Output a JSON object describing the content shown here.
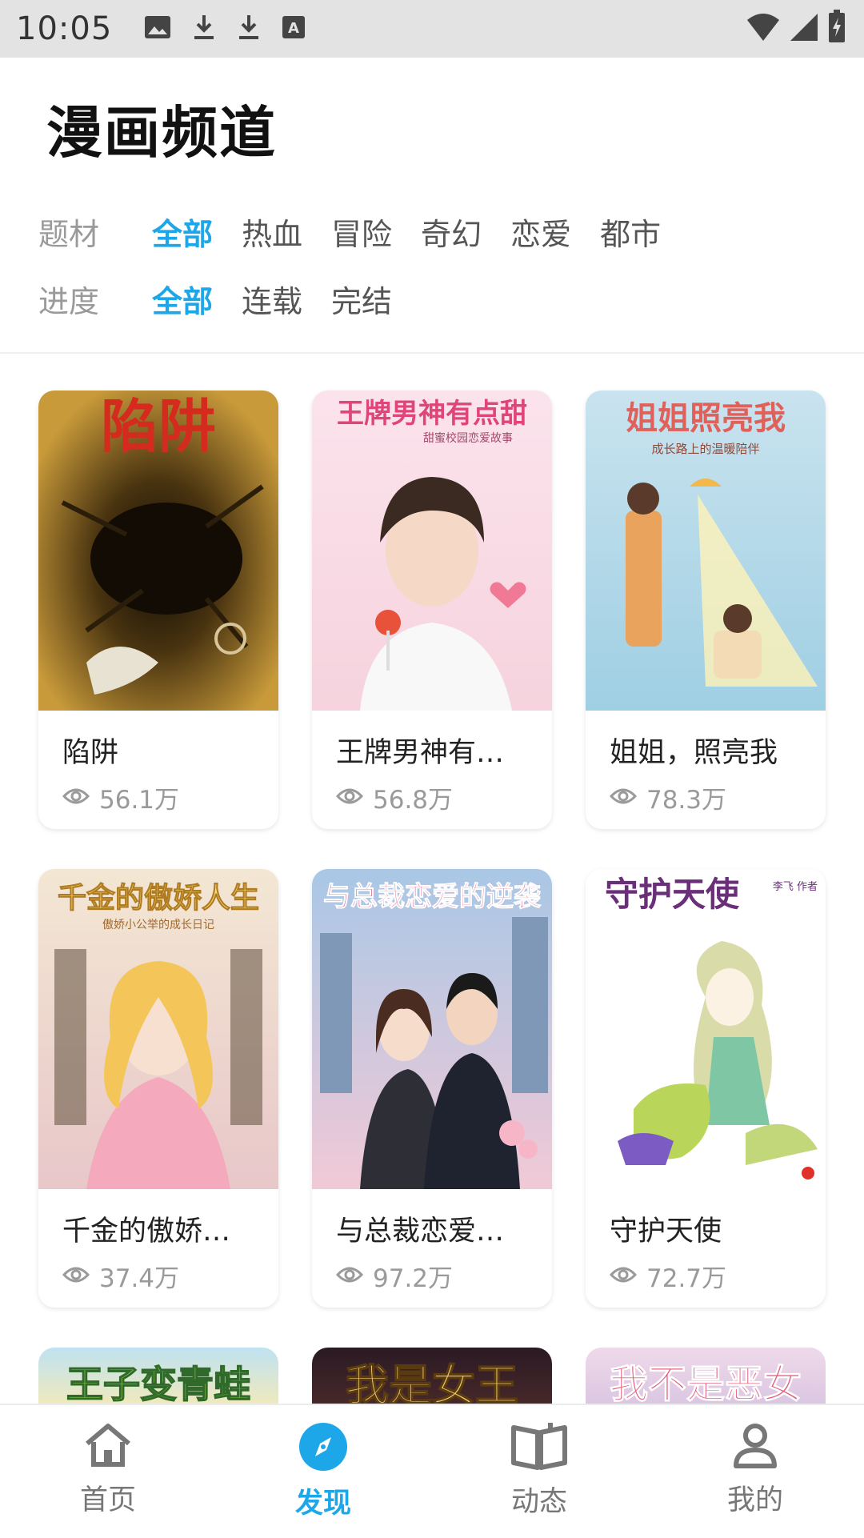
{
  "status_bar": {
    "time": "10:05",
    "icons": [
      "image-icon",
      "download-icon",
      "download-icon",
      "font-icon",
      "wifi-icon",
      "signal-icon",
      "battery-icon"
    ]
  },
  "page": {
    "title": "漫画频道"
  },
  "filters": {
    "genre": {
      "label": "题材",
      "options": [
        "全部",
        "热血",
        "冒险",
        "奇幻",
        "恋爱",
        "都市"
      ],
      "selected": "全部"
    },
    "progress": {
      "label": "进度",
      "options": [
        "全部",
        "连载",
        "完结"
      ],
      "selected": "全部"
    }
  },
  "comics": [
    {
      "title": "陷阱",
      "views": "56.1万",
      "cover_text": "陷阱",
      "cover_subtitle": ""
    },
    {
      "title": "王牌男神有…",
      "views": "56.8万",
      "cover_text": "王牌男神有点甜",
      "cover_subtitle": "甜蜜校园恋爱故事"
    },
    {
      "title": "姐姐，照亮我",
      "views": "78.3万",
      "cover_text": "姐姐照亮我",
      "cover_subtitle": "成长路上的温暖陪伴"
    },
    {
      "title": "千金的傲娇…",
      "views": "37.4万",
      "cover_text": "千金的傲娇人生",
      "cover_subtitle": "傲娇小公举的成长日记"
    },
    {
      "title": "与总裁恋爱…",
      "views": "97.2万",
      "cover_text": "与总裁恋爱的逆袭",
      "cover_subtitle": ""
    },
    {
      "title": "守护天使",
      "views": "72.7万",
      "cover_text": "守护天使",
      "cover_subtitle": "李飞 作者"
    }
  ],
  "peek_covers": [
    "王子变青蛙",
    "我是女王",
    "我不是恶女"
  ],
  "bottom_nav": [
    {
      "label": "首页",
      "icon": "home-icon",
      "active": false
    },
    {
      "label": "发现",
      "icon": "compass-icon",
      "active": true
    },
    {
      "label": "动态",
      "icon": "book-icon",
      "active": false
    },
    {
      "label": "我的",
      "icon": "person-icon",
      "active": false
    }
  ],
  "colors": {
    "accent": "#1ea7e8",
    "muted": "#9a9a9a",
    "status_bar_bg": "#e3e3e3"
  }
}
